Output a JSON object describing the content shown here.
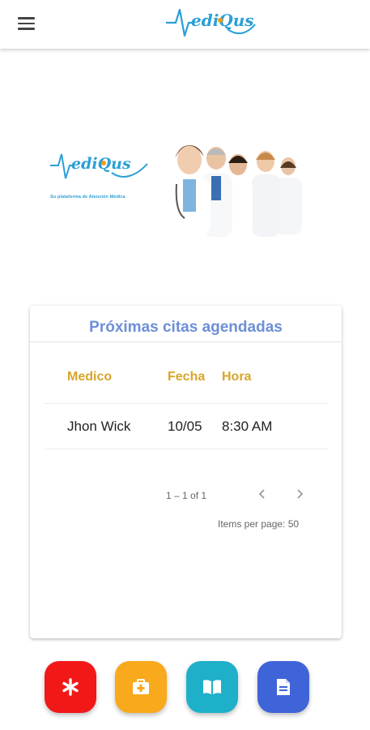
{
  "app": {
    "brand": "MediQus",
    "tagline": "Su plataforma de Atención Médica"
  },
  "colors": {
    "accent_blue": "#2a9fd6",
    "title_blue": "#6d8fd6",
    "header_gold": "#d9a52b",
    "fab_red": "#f21818",
    "fab_orange": "#f9a91c",
    "fab_teal": "#1fb0c9",
    "fab_indigo": "#3f64d8"
  },
  "icons": {
    "menu": "hamburger-menu-icon",
    "prev": "chevron-left-icon",
    "next": "chevron-right-icon",
    "fab1": "asterisk-icon",
    "fab2": "medical-kit-icon",
    "fab3": "open-book-icon",
    "fab4": "document-icon"
  },
  "appointments": {
    "title": "Próximas citas agendadas",
    "columns": [
      "Medico",
      "Fecha",
      "Hora"
    ],
    "rows": [
      [
        "Jhon Wick",
        "10/05",
        "8:30 AM"
      ]
    ],
    "range_label": "1 – 1 of 1",
    "items_per_page": "Items per page:",
    "items_per_page_value": "50"
  }
}
